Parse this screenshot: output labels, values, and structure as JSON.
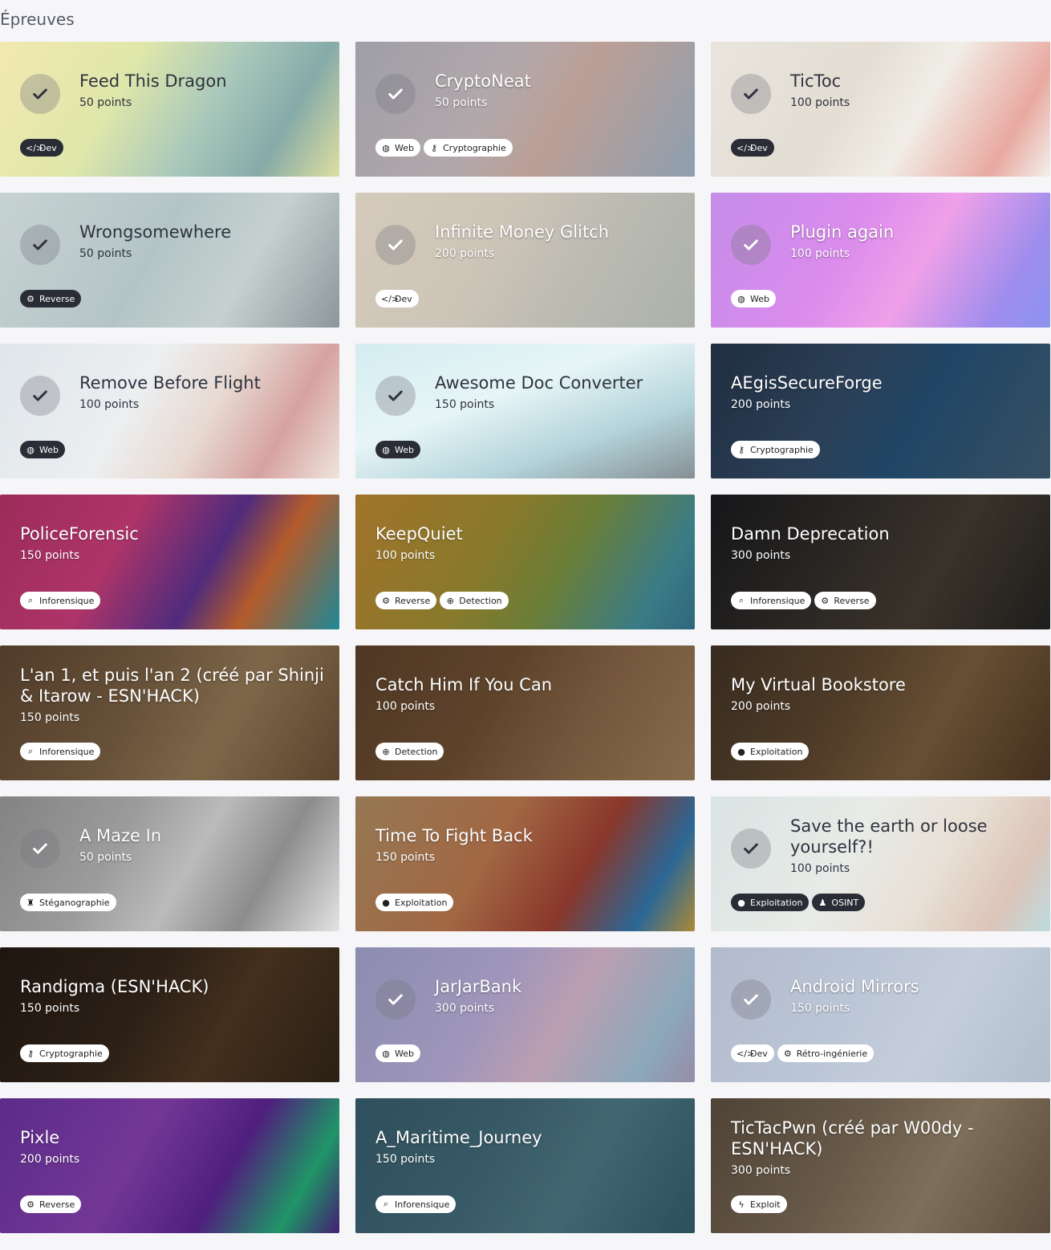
{
  "section_title": "Épreuves",
  "cards": [
    {
      "title": "Feed This Dragon",
      "points": "50 points",
      "done": true,
      "bg": "linear-gradient(120deg,#e8d77a 0%,#c9d66d 35%,#6aa08a 60%,#2f6e6a 80%,#c6c85b 100%)",
      "tags": [
        {
          "label": "Dev",
          "icon": "code-icon",
          "dark": true
        }
      ]
    },
    {
      "title": "CryptoNeat",
      "points": "50 points",
      "done": true,
      "light": true,
      "bg": "linear-gradient(120deg,#5a5866 0%,#7a6a70 40%,#8b5a4a 60%,#3c5a78 100%)",
      "tags": [
        {
          "label": "Web",
          "icon": "globe-icon"
        },
        {
          "label": "Cryptographie",
          "icon": "key-icon"
        }
      ]
    },
    {
      "title": "TicToc",
      "points": "100 points",
      "done": true,
      "bg": "linear-gradient(120deg,#d9d2c4 0%,#cfc6b4 40%,#e7e2d6 60%,#d86b5c 85%,#e9e6de 100%)",
      "tags": [
        {
          "label": "Dev",
          "icon": "code-icon",
          "dark": true
        }
      ]
    },
    {
      "title": "Wrongsomewhere",
      "points": "50 points",
      "done": true,
      "bg": "linear-gradient(120deg,#9fb3b3 0%,#7f9a9c 45%,#9bb0ad 70%,#3b4c54 100%)",
      "tags": [
        {
          "label": "Reverse",
          "icon": "gears-icon",
          "dark": true
        }
      ]
    },
    {
      "title": "Infinite Money Glitch",
      "points": "200 points",
      "done": true,
      "light": true,
      "bg": "linear-gradient(120deg,#b7a58a 0%,#a89a84 40%,#8c8a7a 65%,#6f7a6c 100%)",
      "tags": [
        {
          "label": "Dev",
          "icon": "code-icon"
        }
      ]
    },
    {
      "title": "Plugin again",
      "points": "100 points",
      "done": true,
      "light": true,
      "bg": "linear-gradient(120deg,#9a3ad8 0%,#c23ae0 40%,#e45cd8 60%,#5a3be0 85%,#3a46e6 100%)",
      "tags": [
        {
          "label": "Web",
          "icon": "globe-icon"
        }
      ]
    },
    {
      "title": "Remove Before Flight",
      "points": "100 points",
      "done": true,
      "bg": "linear-gradient(120deg,#c9d4dc 0%,#dfe3e6 40%,#d7bfb1 60%,#b85f5f 80%,#e4d2c2 100%)",
      "tags": [
        {
          "label": "Web",
          "icon": "globe-icon",
          "dark": true
        }
      ]
    },
    {
      "title": "Awesome Doc Converter",
      "points": "150 points",
      "done": true,
      "bg": "linear-gradient(160deg,#b5dfe6 0%,#d6eef0 40%,#7fb6c2 70%,#2e3e48 100%)",
      "tags": [
        {
          "label": "Web",
          "icon": "globe-icon",
          "dark": true
        }
      ]
    },
    {
      "title": "AEgisSecureForge",
      "points": "200 points",
      "done": false,
      "bg": "linear-gradient(120deg,#2b3e56 0%,#3a5676 40%,#2b5e88 60%,#4a6a84 100%)",
      "tags": [
        {
          "label": "Cryptographie",
          "icon": "key-icon"
        }
      ]
    },
    {
      "title": "PoliceForensic",
      "points": "150 points",
      "done": false,
      "bg": "linear-gradient(120deg,#d13a78 0%,#e8468c 35%,#6a3aa6 60%,#f07a3a 75%,#2ab6c8 100%)",
      "tags": [
        {
          "label": "Inforensique",
          "icon": "search-icon"
        }
      ]
    },
    {
      "title": "KeepQuiet",
      "points": "100 points",
      "done": false,
      "bg": "linear-gradient(120deg,#d79a3a 0%,#b6a23a 40%,#8ea84a 60%,#4fa6b2 85%,#3e8aa8 100%)",
      "tags": [
        {
          "label": "Reverse",
          "icon": "gears-icon"
        },
        {
          "label": "Detection",
          "icon": "magnify-icon"
        }
      ]
    },
    {
      "title": "Damn Deprecation",
      "points": "300 points",
      "done": false,
      "bg": "linear-gradient(120deg,#1e1e22 0%,#3a3530 40%,#4e4438 65%,#2a2826 100%)",
      "tags": [
        {
          "label": "Inforensique",
          "icon": "search-icon"
        },
        {
          "label": "Reverse",
          "icon": "gears-icon"
        }
      ]
    },
    {
      "title": "L'an 1, et puis l'an 2 (créé par Shinji & Itarow - ESN'HACK)",
      "points": "150 points",
      "done": false,
      "bg": "linear-gradient(120deg,#6b5038 0%,#8a6c4c 40%,#a88a62 65%,#7a5a3c 100%)",
      "tags": [
        {
          "label": "Inforensique",
          "icon": "search-icon"
        }
      ]
    },
    {
      "title": "Catch Him If You Can",
      "points": "100 points",
      "done": false,
      "bg": "linear-gradient(120deg,#6a4a30 0%,#7e5a3a 40%,#9a7450 65%,#b39068 100%)",
      "tags": [
        {
          "label": "Detection",
          "icon": "magnify-icon"
        }
      ]
    },
    {
      "title": "My Virtual Bookstore",
      "points": "200 points",
      "done": false,
      "bg": "linear-gradient(120deg,#4a3a2a 0%,#6b5136 40%,#8a6a44 65%,#5a4028 100%)",
      "tags": [
        {
          "label": "Exploitation",
          "icon": "bomb-icon"
        }
      ]
    },
    {
      "title": "A Maze In",
      "points": "50 points",
      "done": true,
      "light": true,
      "bg": "linear-gradient(120deg,#2a2a2a 0%,#555 35%,#8a8a8a 55%,#3a3a3a 75%,#d0d0d0 100%)",
      "tags": [
        {
          "label": "Stéganographie",
          "icon": "spy-icon"
        }
      ]
    },
    {
      "title": "Time To Fight Back",
      "points": "150 points",
      "done": false,
      "bg": "linear-gradient(120deg,#c8a070 0%,#d88a5a 40%,#b84a3a 65%,#3a8ac8 85%,#e6b84a 100%)",
      "tags": [
        {
          "label": "Exploitation",
          "icon": "bomb-icon"
        }
      ]
    },
    {
      "title": "Save the earth or loose yourself?!",
      "points": "100 points",
      "done": true,
      "bg": "linear-gradient(120deg,#bfd0cf 0%,#d7ddd7 40%,#d7c9b7 65%,#c39a86 85%,#8fc2c8 100%)",
      "tags": [
        {
          "label": "Exploitation",
          "icon": "bomb-icon",
          "dark": true
        },
        {
          "label": "OSINT",
          "icon": "user-icon",
          "dark": true
        }
      ]
    },
    {
      "title": "Randigma (ESN'HACK)",
      "points": "150 points",
      "done": false,
      "bg": "linear-gradient(120deg,#2a1e16 0%,#3a2a1e 40%,#5a4028 65%,#3a2a1c 100%)",
      "tags": [
        {
          "label": "Cryptographie",
          "icon": "key-icon"
        }
      ]
    },
    {
      "title": "JarJarBank",
      "points": "300 points",
      "done": true,
      "light": true,
      "bg": "linear-gradient(120deg,#3a3a78 0%,#5a4a8a 40%,#8a5a7a 60%,#3a6a8a 85%,#4a3a6a 100%)",
      "tags": [
        {
          "label": "Web",
          "icon": "globe-icon"
        }
      ]
    },
    {
      "title": "Android Mirrors",
      "points": "150 points",
      "done": true,
      "light": true,
      "bg": "linear-gradient(120deg,#7a8aa8 0%,#8a9cb8 40%,#9aaac2 65%,#7a90a8 100%)",
      "tags": [
        {
          "label": "Dev",
          "icon": "code-icon"
        },
        {
          "label": "Rétro-ingénierie",
          "icon": "gears-icon"
        }
      ]
    },
    {
      "title": "Pixle",
      "points": "200 points",
      "done": false,
      "bg": "linear-gradient(120deg,#7a3ab8 0%,#9a4ac8 40%,#6a2aa8 65%,#2ac88a 85%,#5a2a9a 100%)",
      "tags": [
        {
          "label": "Reverse",
          "icon": "gears-icon"
        }
      ]
    },
    {
      "title": "A_Maritime_Journey",
      "points": "150 points",
      "done": false,
      "bg": "linear-gradient(120deg,#3e6a7a 0%,#4a7888 40%,#5a8a98 65%,#3a6a7a 100%)",
      "tags": [
        {
          "label": "Inforensique",
          "icon": "search-icon"
        }
      ]
    },
    {
      "title": "TicTacPwn (créé par W00dy - ESN'HACK)",
      "points": "300 points",
      "done": false,
      "bg": "linear-gradient(120deg,#6a5a4a 0%,#8a7860 40%,#a89478 65%,#7a6650 100%)",
      "tags": [
        {
          "label": "Exploit",
          "icon": "bolt-icon"
        }
      ]
    }
  ]
}
